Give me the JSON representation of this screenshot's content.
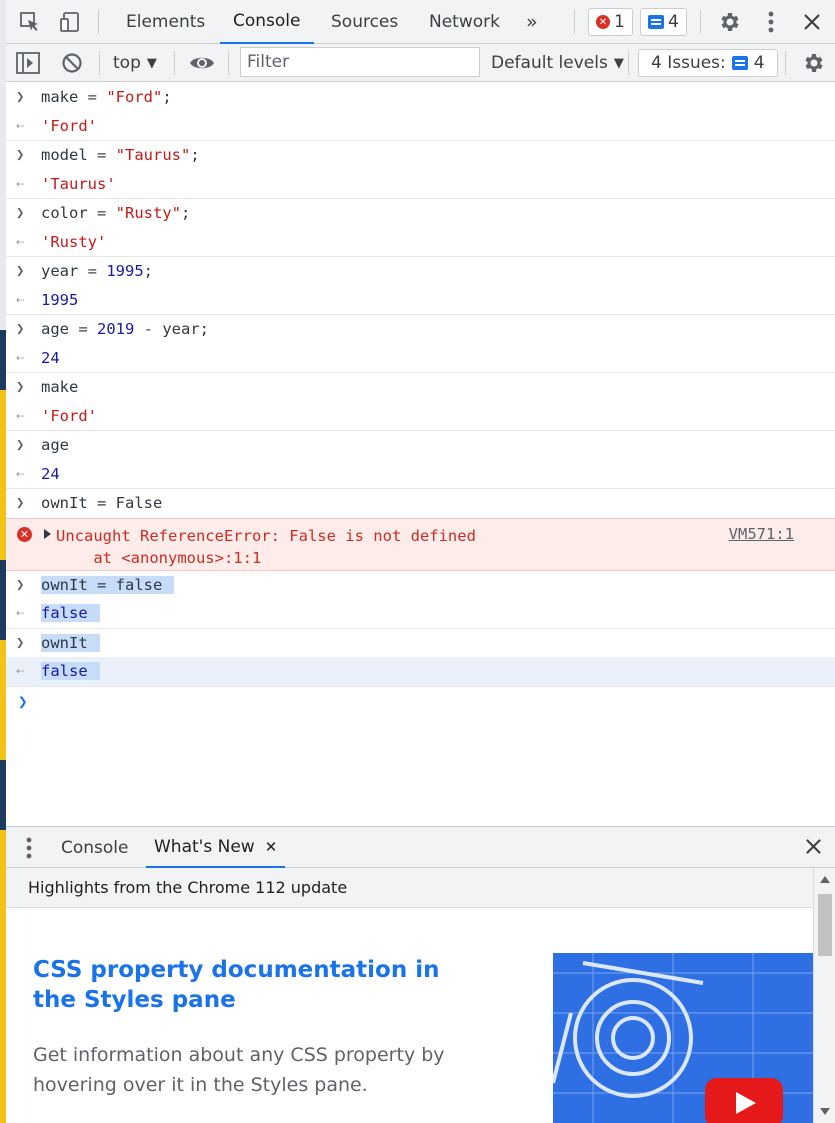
{
  "toolbar": {
    "tabs": [
      "Elements",
      "Console",
      "Sources",
      "Network"
    ],
    "more_tabs": "»",
    "error_count": "1",
    "message_count": "4"
  },
  "toolbar2": {
    "context": "top",
    "filter_placeholder": "Filter",
    "levels": "Default levels",
    "issues_label": "4 Issues:",
    "issues_count": "4"
  },
  "console": {
    "entries": [
      {
        "input": [
          "make",
          " = ",
          "\"Ford\"",
          ";"
        ],
        "output": "'Ford'"
      },
      {
        "input": [
          "model",
          " = ",
          "\"Taurus\"",
          ";"
        ],
        "output": "'Taurus'"
      },
      {
        "input": [
          "color",
          " = ",
          "\"Rusty\"",
          ";"
        ],
        "output": "'Rusty'"
      },
      {
        "input": [
          "year",
          " = ",
          "1995",
          ";"
        ],
        "output": "1995"
      },
      {
        "input": [
          "age",
          " = ",
          "2019",
          " - ",
          "year;"
        ],
        "output": "24"
      },
      {
        "input": [
          "make"
        ],
        "output": "'Ford'"
      },
      {
        "input": [
          "age"
        ],
        "output": "24"
      },
      {
        "input": [
          "ownIt = False"
        ]
      },
      {
        "error_line1": "Uncaught ReferenceError: False is not defined",
        "error_line2": "    at <anonymous>:1:1",
        "error_source": "VM571:1"
      },
      {
        "input": [
          "ownIt = false"
        ],
        "output": "false"
      },
      {
        "input": [
          "ownIt"
        ],
        "output": "false"
      }
    ]
  },
  "drawer": {
    "tabs": [
      "Console",
      "What's New"
    ],
    "subheading": "Highlights from the Chrome 112 update",
    "feature_title": "CSS property documentation in the Styles pane",
    "feature_desc": "Get information about any CSS property by hovering over it in the Styles pane."
  },
  "colors": {
    "accent": "#1a73e8",
    "error": "#d93025",
    "string": "#c41a16",
    "number": "#1a1aa6"
  }
}
